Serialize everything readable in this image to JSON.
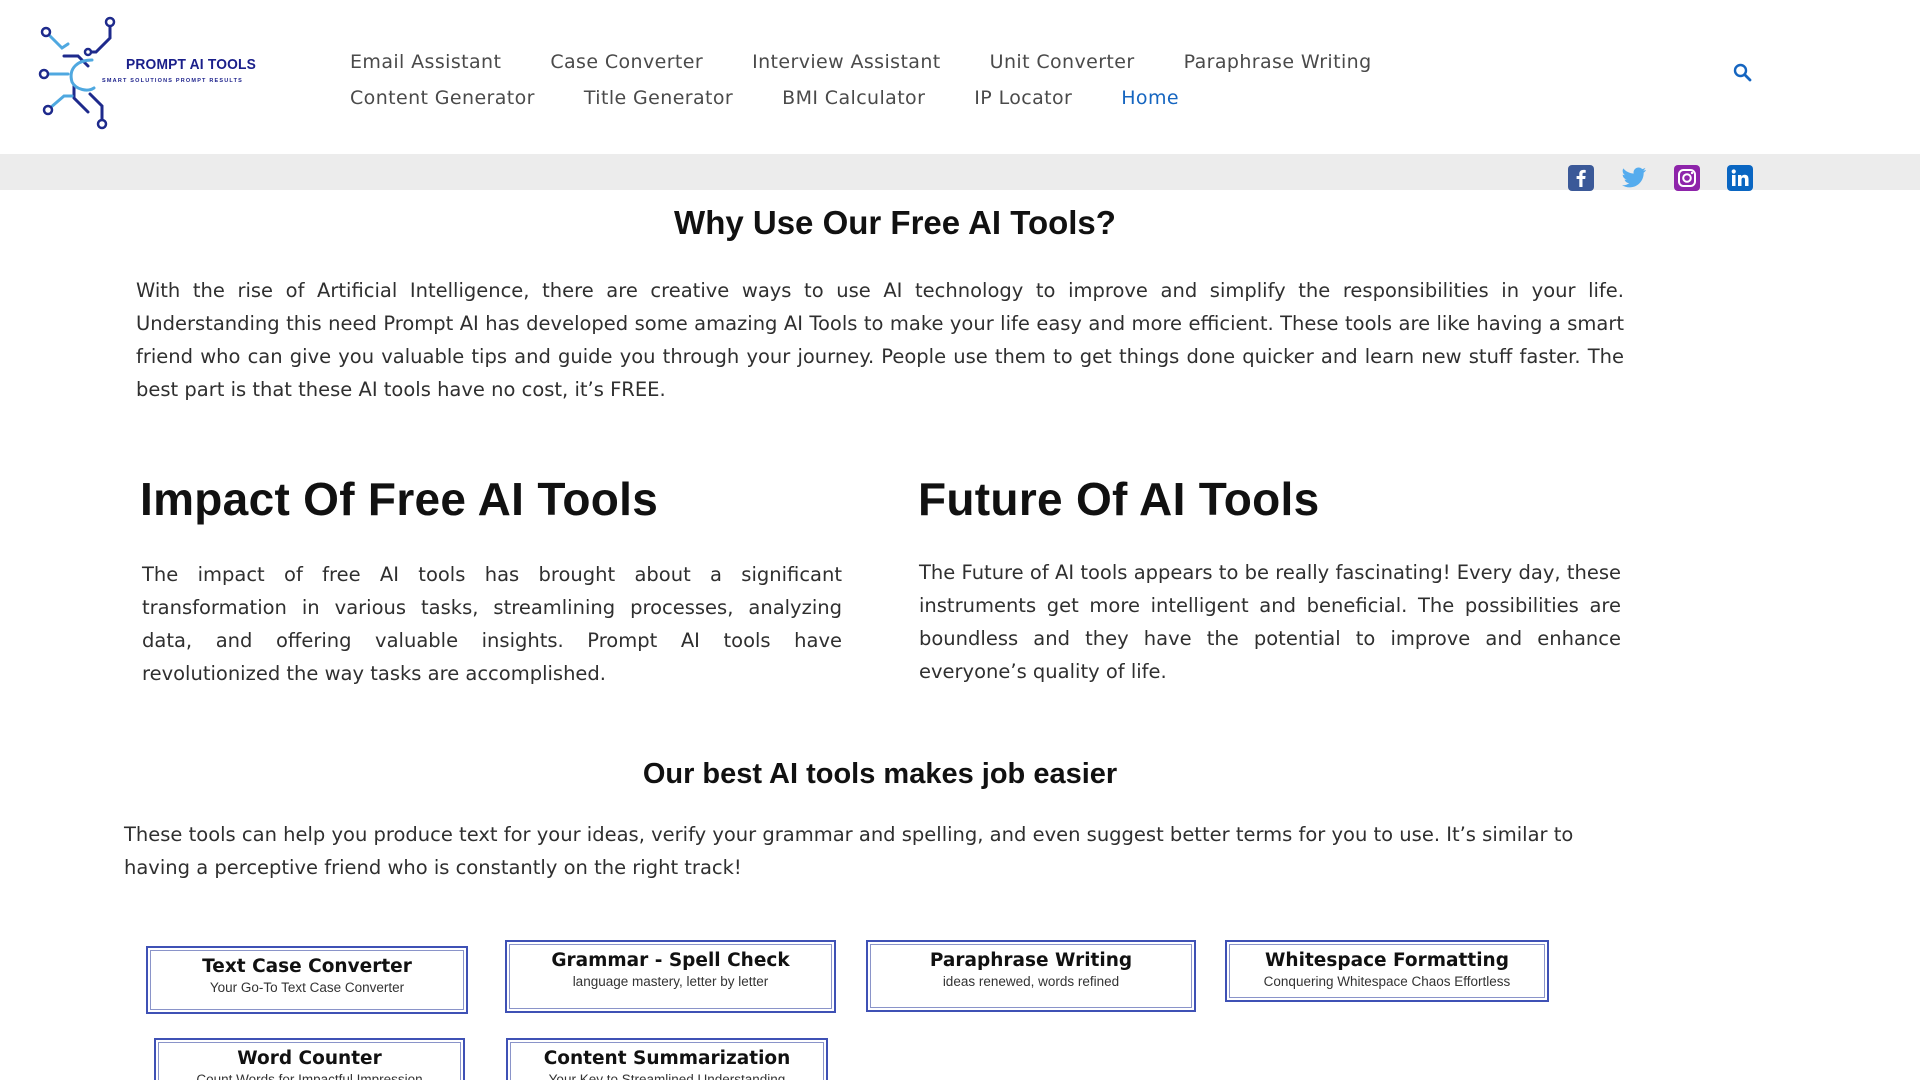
{
  "logo": {
    "name": "PROMPT AI TOOLS",
    "tagline": "SMART SOLUTIONS PROMPT RESULTS"
  },
  "nav": {
    "row1": [
      "Email Assistant",
      "Case Converter",
      "Interview Assistant",
      "Unit Converter",
      "Paraphrase Writing"
    ],
    "row2": [
      "Content Generator",
      "Title Generator",
      "BMI Calculator",
      "IP Locator",
      "Home"
    ],
    "active": "Home"
  },
  "social": {
    "facebook_color": "#3b5998",
    "twitter_color": "#55acee",
    "instagram_color": "#8e24aa",
    "linkedin_color": "#0a66c2"
  },
  "why": {
    "heading": "Why Use Our Free AI Tools?",
    "text": "With the rise of Artificial Intelligence, there are creative ways to use AI technology to improve and simplify the responsibilities in your life. Understanding this need Prompt AI has developed some amazing AI Tools to make your life easy and more efficient. These tools are like having a smart friend who can give you valuable tips and guide you through your journey. People use them to get things done quicker and learn new stuff faster. The best part is that these AI tools have no cost, it’s FREE."
  },
  "impact": {
    "heading": "Impact Of Free AI Tools",
    "text": "The impact of free AI tools has brought about a significant transformation in various tasks, streamlining processes, analyzing data, and offering valuable insights. Prompt AI tools have revolutionized the way tasks are accomplished."
  },
  "future": {
    "heading": "Future Of AI Tools",
    "text": "The Future of AI tools appears to be really fascinating! Every day, these instruments get more intelligent and beneficial. The possibilities are boundless and they have the potential to improve and enhance everyone’s quality of life."
  },
  "best": {
    "heading": "Our best AI tools makes job easier",
    "text": "These tools can help you produce text for your ideas, verify your grammar and spelling, and even suggest better terms for you to use. It’s similar to having a perceptive friend who is constantly on the right track!"
  },
  "cards": [
    {
      "title": "Text Case Converter",
      "subtitle": "Your Go-To Text Case Converter"
    },
    {
      "title": "Grammar - Spell Check",
      "subtitle": "language mastery, letter by letter"
    },
    {
      "title": "Paraphrase Writing",
      "subtitle": "ideas renewed, words refined"
    },
    {
      "title": "Whitespace Formatting",
      "subtitle": "Conquering Whitespace Chaos Effortless"
    },
    {
      "title": "Word Counter",
      "subtitle": "Count Words for Impactful Impression"
    },
    {
      "title": "Content Summarization",
      "subtitle": "Your Key to Streamlined Understanding"
    }
  ]
}
